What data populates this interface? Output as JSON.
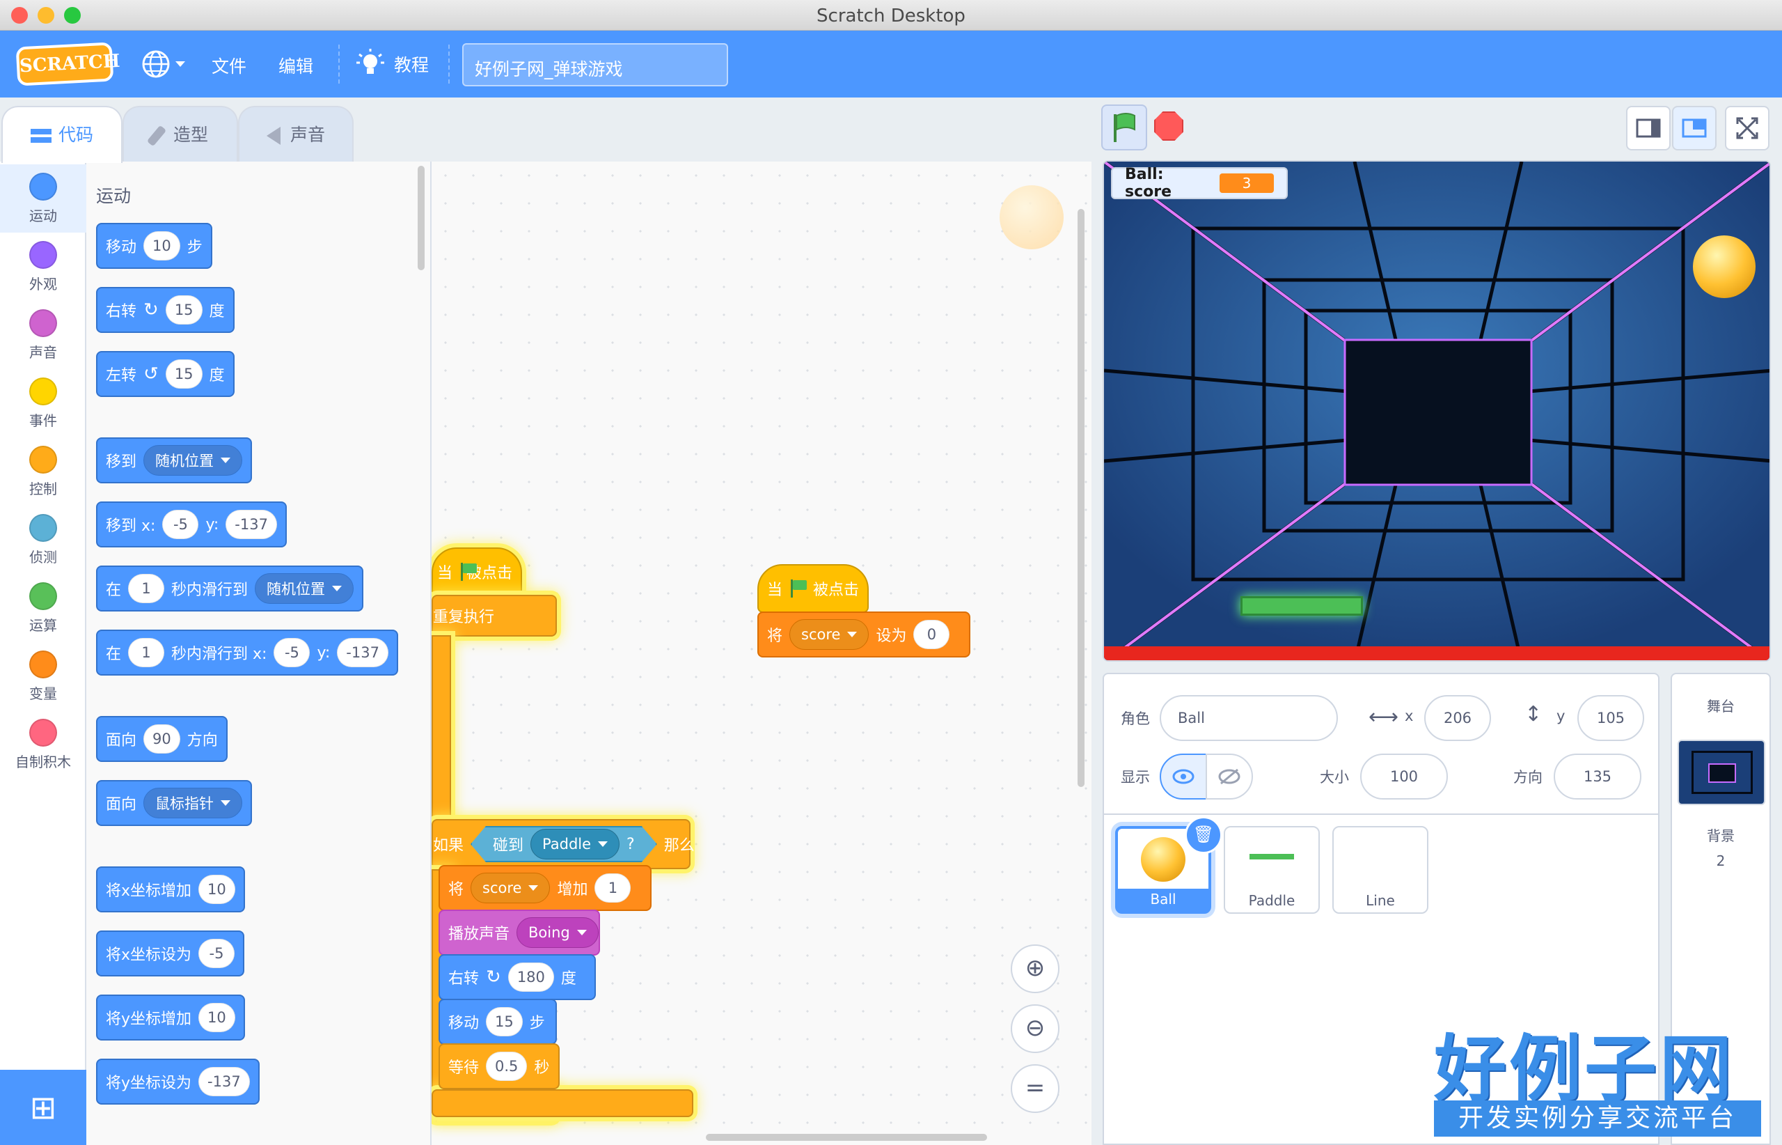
{
  "window": {
    "title": "Scratch Desktop"
  },
  "menubar": {
    "logo": "SCRATCH",
    "file": "文件",
    "edit": "编辑",
    "tutorials": "教程",
    "project_title": "好例子网_弹球游戏"
  },
  "tabs": {
    "code": "代码",
    "costumes": "造型",
    "sounds": "声音"
  },
  "categories": [
    "运动",
    "外观",
    "声音",
    "事件",
    "控制",
    "侦测",
    "运算",
    "变量",
    "自制积木"
  ],
  "category_colors": [
    "#4c97ff",
    "#9966ff",
    "#cf63cf",
    "#ffd500",
    "#ffab19",
    "#5cb1d6",
    "#59c059",
    "#ff8c1a",
    "#ff6680"
  ],
  "palette": {
    "heading": "运动",
    "move": {
      "a": "移动",
      "n": "10",
      "b": "步"
    },
    "turn_right": {
      "a": "右转",
      "n": "15",
      "b": "度"
    },
    "turn_left": {
      "a": "左转",
      "n": "15",
      "b": "度"
    },
    "goto": {
      "a": "移到",
      "opt": "随机位置"
    },
    "goto_xy": {
      "a": "移到 x:",
      "x": "-5",
      "b": "y:",
      "y": "-137"
    },
    "glide": {
      "a": "在",
      "n": "1",
      "b": "秒内滑行到",
      "opt": "随机位置"
    },
    "glide_xy": {
      "a": "在",
      "n": "1",
      "b": "秒内滑行到 x:",
      "x": "-5",
      "c": "y:",
      "y": "-137"
    },
    "point_dir": {
      "a": "面向",
      "n": "90",
      "b": "方向"
    },
    "point_towards": {
      "a": "面向",
      "opt": "鼠标指针"
    },
    "change_x": {
      "a": "将x坐标增加",
      "n": "10"
    },
    "set_x": {
      "a": "将x坐标设为",
      "n": "-5"
    },
    "change_y": {
      "a": "将y坐标增加",
      "n": "10"
    },
    "set_y": {
      "a": "将y坐标设为",
      "n": "-137"
    }
  },
  "script1": {
    "hat_when": "当",
    "hat_clicked": "被点击",
    "forever": "重复执行",
    "if": "如果",
    "touching": "碰到",
    "touch_target": "Paddle",
    "q": "?",
    "then": "那么",
    "change_a": "将",
    "change_var": "score",
    "change_b": "增加",
    "change_n": "1",
    "sound_a": "播放声音",
    "sound_name": "Boing",
    "turn_a": "右转",
    "turn_n": "180",
    "turn_b": "度",
    "move_a": "移动",
    "move_n": "15",
    "move_b": "步",
    "wait_a": "等待",
    "wait_n": "0.5",
    "wait_b": "秒"
  },
  "script2": {
    "hat_when": "当",
    "hat_clicked": "被点击",
    "set_a": "将",
    "set_var": "score",
    "set_b": "设为",
    "set_n": "0"
  },
  "stage": {
    "monitor_label": "Ball: score",
    "monitor_value": "3"
  },
  "sprite_info": {
    "sprite_label": "角色",
    "sprite_name": "Ball",
    "x_label": "x",
    "x": "206",
    "y_label": "y",
    "y": "105",
    "show_label": "显示",
    "size_label": "大小",
    "size": "100",
    "dir_label": "方向",
    "direction": "135"
  },
  "sprites": [
    "Ball",
    "Paddle",
    "Line"
  ],
  "stage_target": {
    "title": "舞台",
    "backdrops_label": "背景",
    "backdrops_count": "2"
  },
  "watermark": {
    "main": "好例子网",
    "sub": "开发实例分享交流平台"
  }
}
